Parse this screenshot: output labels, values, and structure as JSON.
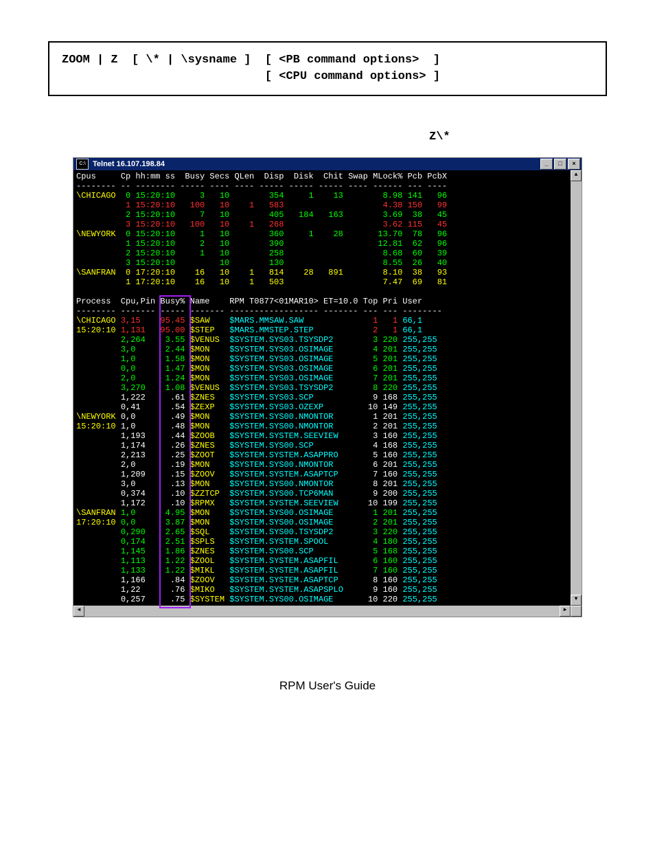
{
  "syntax": "ZOOM | Z  [ \\* | \\sysname ]  [ <PB command options>  ]\n                             [ <CPU command options> ]",
  "cmd_example": "Z\\*",
  "window": {
    "title": "Telnet 16.107.198.84",
    "icon_label": "C:\\",
    "btn_min": "_",
    "btn_max": "□",
    "btn_close": "×"
  },
  "cpus_header": "Cpus     Cp hh:mm ss  Busy Secs QLen  Disp  Disk  Chit Swap MLock% Pcb PcbX",
  "cpus_divider": "-------- -- -------- ----- ---- ---- ----- ----- ----- ---- ------ --- ----",
  "cpus_rows": [
    {
      "sys": "\\CHICAGO",
      "cp": "0",
      "time": "15:20:10",
      "busy": "3",
      "secs": "10",
      "qlen": "",
      "disp": "354",
      "disk": "1",
      "chit": "13",
      "swap": "",
      "mlock": "8.98",
      "pcb": "141",
      "pcbx": "96",
      "color": "grn"
    },
    {
      "sys": "",
      "cp": "1",
      "time": "15:20:10",
      "busy": "100",
      "secs": "10",
      "qlen": "1",
      "disp": "583",
      "disk": "",
      "chit": "",
      "swap": "",
      "mlock": "4.38",
      "pcb": "150",
      "pcbx": "99",
      "color": "red"
    },
    {
      "sys": "",
      "cp": "2",
      "time": "15:20:10",
      "busy": "7",
      "secs": "10",
      "qlen": "",
      "disp": "405",
      "disk": "184",
      "chit": "163",
      "swap": "",
      "mlock": "3.69",
      "pcb": "38",
      "pcbx": "45",
      "color": "grn"
    },
    {
      "sys": "",
      "cp": "3",
      "time": "15:20:10",
      "busy": "100",
      "secs": "10",
      "qlen": "1",
      "disp": "268",
      "disk": "",
      "chit": "",
      "swap": "",
      "mlock": "3.62",
      "pcb": "115",
      "pcbx": "45",
      "color": "red"
    },
    {
      "sys": "\\NEWYORK",
      "cp": "0",
      "time": "15:20:10",
      "busy": "1",
      "secs": "10",
      "qlen": "",
      "disp": "360",
      "disk": "1",
      "chit": "28",
      "swap": "",
      "mlock": "13.70",
      "pcb": "78",
      "pcbx": "96",
      "color": "grn"
    },
    {
      "sys": "",
      "cp": "1",
      "time": "15:20:10",
      "busy": "2",
      "secs": "10",
      "qlen": "",
      "disp": "390",
      "disk": "",
      "chit": "",
      "swap": "",
      "mlock": "12.81",
      "pcb": "62",
      "pcbx": "96",
      "color": "grn"
    },
    {
      "sys": "",
      "cp": "2",
      "time": "15:20:10",
      "busy": "1",
      "secs": "10",
      "qlen": "",
      "disp": "258",
      "disk": "",
      "chit": "",
      "swap": "",
      "mlock": "8.68",
      "pcb": "60",
      "pcbx": "39",
      "color": "grn"
    },
    {
      "sys": "",
      "cp": "3",
      "time": "15:20:10",
      "busy": "",
      "secs": "10",
      "qlen": "",
      "disp": "130",
      "disk": "",
      "chit": "",
      "swap": "",
      "mlock": "8.55",
      "pcb": "26",
      "pcbx": "40",
      "color": "grn"
    },
    {
      "sys": "\\SANFRAN",
      "cp": "0",
      "time": "17:20:10",
      "busy": "16",
      "secs": "10",
      "qlen": "1",
      "disp": "814",
      "disk": "28",
      "chit": "891",
      "swap": "",
      "mlock": "8.10",
      "pcb": "38",
      "pcbx": "93",
      "color": "yel"
    },
    {
      "sys": "",
      "cp": "1",
      "time": "17:20:10",
      "busy": "16",
      "secs": "10",
      "qlen": "1",
      "disp": "503",
      "disk": "",
      "chit": "",
      "swap": "",
      "mlock": "7.47",
      "pcb": "69",
      "pcbx": "81",
      "color": "yel"
    }
  ],
  "proc_header": "Process  Cpu,Pin Busy% Name    RPM T0877<01MAR10> ET=10.0 Top Pri User",
  "proc_divider": "-------- ------- ----- ------- ------------------ ------- --- --- --------",
  "busy_col_label": "Busy%",
  "proc_rows": [
    {
      "sys": "\\CHICAGO",
      "time": "15:20:10",
      "cpu": "3,15",
      "busy": "95.45",
      "name": "$SAW",
      "prog": "$MARS.MMSAW.SAW",
      "top": "1",
      "pri": "1",
      "user": "66,1",
      "color": "red"
    },
    {
      "sys": "",
      "time": "",
      "cpu": "1,131",
      "busy": "95.00",
      "name": "$STEP",
      "prog": "$MARS.MMSTEP.STEP",
      "top": "2",
      "pri": "1",
      "user": "66,1",
      "color": "red"
    },
    {
      "sys": "",
      "time": "",
      "cpu": "2,264",
      "busy": "3.55",
      "name": "$VENUS",
      "prog": "$SYSTEM.SYS03.TSYSDP2",
      "top": "3",
      "pri": "220",
      "user": "255,255",
      "color": "grn"
    },
    {
      "sys": "",
      "time": "",
      "cpu": "3,0",
      "busy": "2.44",
      "name": "$MON",
      "prog": "$SYSTEM.SYS03.OSIMAGE",
      "top": "4",
      "pri": "201",
      "user": "255,255",
      "color": "grn"
    },
    {
      "sys": "",
      "time": "",
      "cpu": "1,0",
      "busy": "1.58",
      "name": "$MON",
      "prog": "$SYSTEM.SYS03.OSIMAGE",
      "top": "5",
      "pri": "201",
      "user": "255,255",
      "color": "grn"
    },
    {
      "sys": "",
      "time": "",
      "cpu": "0,0",
      "busy": "1.47",
      "name": "$MON",
      "prog": "$SYSTEM.SYS03.OSIMAGE",
      "top": "6",
      "pri": "201",
      "user": "255,255",
      "color": "grn"
    },
    {
      "sys": "",
      "time": "",
      "cpu": "2,0",
      "busy": "1.24",
      "name": "$MON",
      "prog": "$SYSTEM.SYS03.OSIMAGE",
      "top": "7",
      "pri": "201",
      "user": "255,255",
      "color": "grn"
    },
    {
      "sys": "",
      "time": "",
      "cpu": "3,270",
      "busy": "1.08",
      "name": "$VENUS",
      "prog": "$SYSTEM.SYS03.TSYSDP2",
      "top": "8",
      "pri": "220",
      "user": "255,255",
      "color": "grn"
    },
    {
      "sys": "",
      "time": "",
      "cpu": "1,222",
      "busy": ".61",
      "name": "$ZNES",
      "prog": "$SYSTEM.SYS03.SCP",
      "top": "9",
      "pri": "168",
      "user": "255,255",
      "color": "wht"
    },
    {
      "sys": "",
      "time": "",
      "cpu": "0,41",
      "busy": ".54",
      "name": "$ZEXP",
      "prog": "$SYSTEM.SYS03.OZEXP",
      "top": "10",
      "pri": "149",
      "user": "255,255",
      "color": "wht"
    },
    {
      "sys": "\\NEWYORK",
      "time": "15:20:10",
      "cpu": "0,0",
      "busy": ".49",
      "name": "$MON",
      "prog": "$SYSTEM.SYS00.NMONTOR",
      "top": "1",
      "pri": "201",
      "user": "255,255",
      "color": "wht"
    },
    {
      "sys": "",
      "time": "",
      "cpu": "1,0",
      "busy": ".48",
      "name": "$MON",
      "prog": "$SYSTEM.SYS00.NMONTOR",
      "top": "2",
      "pri": "201",
      "user": "255,255",
      "color": "wht"
    },
    {
      "sys": "",
      "time": "",
      "cpu": "1,193",
      "busy": ".44",
      "name": "$ZOOB",
      "prog": "$SYSTEM.SYSTEM.SEEVIEW",
      "top": "3",
      "pri": "160",
      "user": "255,255",
      "color": "wht"
    },
    {
      "sys": "",
      "time": "",
      "cpu": "1,174",
      "busy": ".26",
      "name": "$ZNES",
      "prog": "$SYSTEM.SYS00.SCP",
      "top": "4",
      "pri": "168",
      "user": "255,255",
      "color": "wht"
    },
    {
      "sys": "",
      "time": "",
      "cpu": "2,213",
      "busy": ".25",
      "name": "$ZOOT",
      "prog": "$SYSTEM.SYSTEM.ASAPPRO",
      "top": "5",
      "pri": "160",
      "user": "255,255",
      "color": "wht"
    },
    {
      "sys": "",
      "time": "",
      "cpu": "2,0",
      "busy": ".19",
      "name": "$MON",
      "prog": "$SYSTEM.SYS00.NMONTOR",
      "top": "6",
      "pri": "201",
      "user": "255,255",
      "color": "wht"
    },
    {
      "sys": "",
      "time": "",
      "cpu": "1,209",
      "busy": ".15",
      "name": "$ZOOV",
      "prog": "$SYSTEM.SYSTEM.ASAPTCP",
      "top": "7",
      "pri": "160",
      "user": "255,255",
      "color": "wht"
    },
    {
      "sys": "",
      "time": "",
      "cpu": "3,0",
      "busy": ".13",
      "name": "$MON",
      "prog": "$SYSTEM.SYS00.NMONTOR",
      "top": "8",
      "pri": "201",
      "user": "255,255",
      "color": "wht"
    },
    {
      "sys": "",
      "time": "",
      "cpu": "0,374",
      "busy": ".10",
      "name": "$ZZTCP",
      "prog": "$SYSTEM.SYS00.TCP6MAN",
      "top": "9",
      "pri": "200",
      "user": "255,255",
      "color": "wht"
    },
    {
      "sys": "",
      "time": "",
      "cpu": "1,172",
      "busy": ".10",
      "name": "$RPMX",
      "prog": "$SYSTEM.SYSTEM.SEEVIEW",
      "top": "10",
      "pri": "199",
      "user": "255,255",
      "color": "wht"
    },
    {
      "sys": "\\SANFRAN",
      "time": "17:20:10",
      "cpu": "1,0",
      "busy": "4.95",
      "name": "$MON",
      "prog": "$SYSTEM.SYS00.OSIMAGE",
      "top": "1",
      "pri": "201",
      "user": "255,255",
      "color": "grn"
    },
    {
      "sys": "",
      "time": "",
      "cpu": "0,0",
      "busy": "3.87",
      "name": "$MON",
      "prog": "$SYSTEM.SYS00.OSIMAGE",
      "top": "2",
      "pri": "201",
      "user": "255,255",
      "color": "grn"
    },
    {
      "sys": "",
      "time": "",
      "cpu": "0,290",
      "busy": "2.65",
      "name": "$SQL",
      "prog": "$SYSTEM.SYS00.TSYSDP2",
      "top": "3",
      "pri": "220",
      "user": "255,255",
      "color": "grn"
    },
    {
      "sys": "",
      "time": "",
      "cpu": "0,174",
      "busy": "2.51",
      "name": "$SPLS",
      "prog": "$SYSTEM.SYSTEM.SPOOL",
      "top": "4",
      "pri": "180",
      "user": "255,255",
      "color": "grn"
    },
    {
      "sys": "",
      "time": "",
      "cpu": "1,145",
      "busy": "1.86",
      "name": "$ZNES",
      "prog": "$SYSTEM.SYS00.SCP",
      "top": "5",
      "pri": "168",
      "user": "255,255",
      "color": "grn"
    },
    {
      "sys": "",
      "time": "",
      "cpu": "1,113",
      "busy": "1.22",
      "name": "$ZOOL",
      "prog": "$SYSTEM.SYSTEM.ASAPFIL",
      "top": "6",
      "pri": "160",
      "user": "255,255",
      "color": "grn"
    },
    {
      "sys": "",
      "time": "",
      "cpu": "1,133",
      "busy": "1.22",
      "name": "$MIKL",
      "prog": "$SYSTEM.SYSTEM.ASAPFIL",
      "top": "7",
      "pri": "160",
      "user": "255,255",
      "color": "grn"
    },
    {
      "sys": "",
      "time": "",
      "cpu": "1,166",
      "busy": ".84",
      "name": "$ZOOV",
      "prog": "$SYSTEM.SYSTEM.ASAPTCP",
      "top": "8",
      "pri": "160",
      "user": "255,255",
      "color": "wht"
    },
    {
      "sys": "",
      "time": "",
      "cpu": "1,22",
      "busy": ".76",
      "name": "$MIKO",
      "prog": "$SYSTEM.SYSTEM.ASAPSPLO",
      "top": "9",
      "pri": "160",
      "user": "255,255",
      "color": "wht"
    },
    {
      "sys": "",
      "time": "",
      "cpu": "0,257",
      "busy": ".75",
      "name": "$SYSTEM",
      "prog": "$SYSTEM.SYS00.OSIMAGE",
      "top": "10",
      "pri": "220",
      "user": "255,255",
      "color": "wht"
    }
  ],
  "footer": "RPM User's Guide"
}
